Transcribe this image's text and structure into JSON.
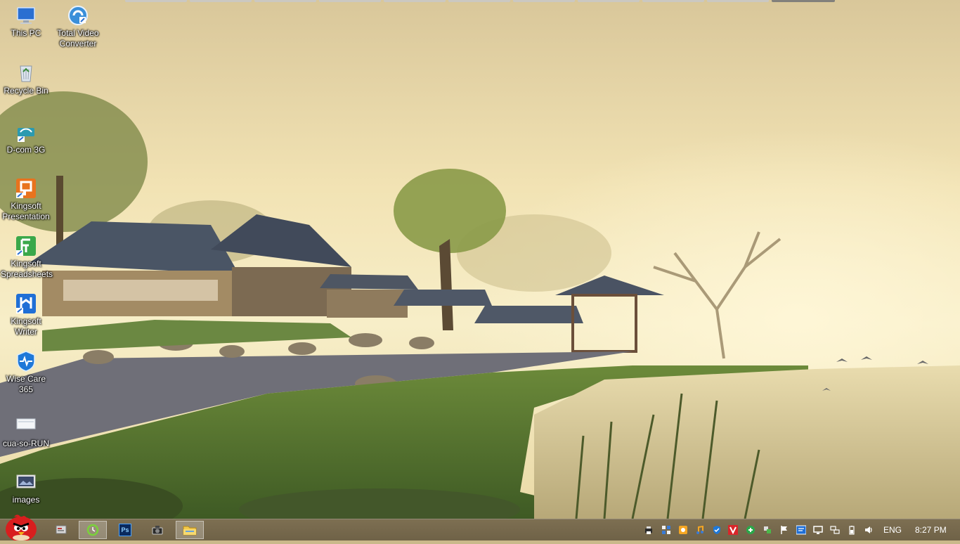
{
  "desktop": {
    "icons": [
      {
        "label": "This PC",
        "icon": "this-pc-icon"
      },
      {
        "label": "Total Video\nConverter",
        "icon": "total-video-converter-icon"
      },
      {
        "label": "Recycle Bin",
        "icon": "recycle-bin-icon"
      },
      {
        "label": "D-com 3G",
        "icon": "dcom-3g-icon"
      },
      {
        "label": "Kingsoft\nPresentation",
        "icon": "kingsoft-presentation-icon"
      },
      {
        "label": "Kingsoft\nSpreadsheets",
        "icon": "kingsoft-spreadsheets-icon"
      },
      {
        "label": "Kingsoft\nWriter",
        "icon": "kingsoft-writer-icon"
      },
      {
        "label": "Wise Care\n365",
        "icon": "wise-care-365-icon"
      },
      {
        "label": "cua-so-RUN",
        "icon": "shortcut-file-icon"
      },
      {
        "label": "images",
        "icon": "image-file-icon"
      }
    ]
  },
  "taskbar": {
    "start_icon": "angry-bird-start-icon",
    "apps": [
      {
        "name": "app-1",
        "icon": "taskbar-app-icon"
      },
      {
        "name": "app-2",
        "icon": "green-circle-app-icon"
      },
      {
        "name": "photoshop",
        "icon": "photoshop-icon",
        "text": "Ps"
      },
      {
        "name": "camera",
        "icon": "camera-icon"
      },
      {
        "name": "file-explorer",
        "icon": "folder-icon"
      }
    ],
    "tray": {
      "icons": [
        "printer-icon",
        "grid-icon",
        "orange-app-icon",
        "music-icon",
        "shield-icon",
        "v-app-icon",
        "green-app-icon",
        "network-icon",
        "flag-icon",
        "blue-app-icon",
        "monitor-icon",
        "network-wired-icon",
        "battery-icon",
        "volume-icon"
      ],
      "language": "ENG",
      "time": "8:27 PM"
    }
  },
  "colors": {
    "sky": "#f3e6b8",
    "taskbar": "#76694c"
  }
}
